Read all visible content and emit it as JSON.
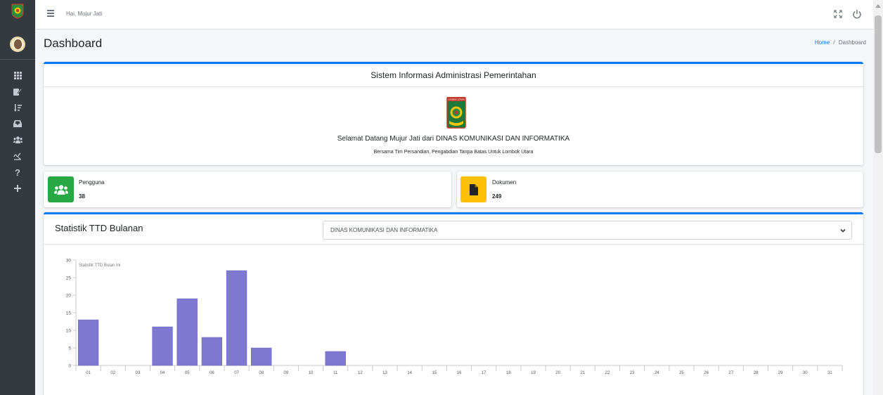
{
  "topbar": {
    "greeting": "Hai, Mujur Jati"
  },
  "icons": {
    "sidebar": [
      "th-icon",
      "edit-icon",
      "sort-icon",
      "inbox-icon",
      "users-icon",
      "signature-icon",
      "question-icon",
      "plus-icon"
    ],
    "topbar": [
      "hamburger-icon",
      "expand-icon",
      "power-icon"
    ]
  },
  "header": {
    "title": "Dashboard",
    "breadcrumb_home": "Home",
    "breadcrumb_sep": "/",
    "breadcrumb_current": "Dashboard"
  },
  "welcome_card": {
    "title": "Sistem Informasi Administrasi Pemerintahan",
    "emblem_text": "LOMBOK UTARA",
    "welcome": "Selamat Datang Mujur Jati dari DINAS KOMUNIKASI DAN INFORMATIKA",
    "tagline": "Bersama Tim Persandian, Pengabdian Tanpa Batas Untuk Lombok Utara"
  },
  "stats": {
    "pengguna": {
      "label": "Pengguna",
      "value": "38",
      "color": "#28a745"
    },
    "dokumen": {
      "label": "Dokumen",
      "value": "249",
      "color": "#ffc107"
    }
  },
  "chart_card": {
    "title": "Statistik TTD Bulanan",
    "selected": "DINAS KOMUNIKASI DAN INFORMATIKA"
  },
  "chart_data": {
    "type": "bar",
    "series_label": "Statistik TTD Bulan Ini",
    "categories": [
      "01",
      "02",
      "03",
      "04",
      "05",
      "06",
      "07",
      "08",
      "09",
      "10",
      "11",
      "12",
      "13",
      "14",
      "15",
      "16",
      "17",
      "18",
      "19",
      "20",
      "21",
      "22",
      "23",
      "24",
      "25",
      "26",
      "27",
      "28",
      "29",
      "30",
      "31"
    ],
    "values": [
      13,
      0,
      0,
      11,
      19,
      8,
      27,
      5,
      0,
      0,
      4,
      0,
      0,
      0,
      0,
      0,
      0,
      0,
      0,
      0,
      0,
      0,
      0,
      0,
      0,
      0,
      0,
      0,
      0,
      0,
      0
    ],
    "ylim": [
      0,
      30
    ],
    "yticks": [
      0,
      5,
      10,
      15,
      20,
      25,
      30
    ],
    "bar_color": "#7e78d2",
    "grid": false
  },
  "colors": {
    "accent": "#007bff",
    "sidebar": "#343a40"
  }
}
